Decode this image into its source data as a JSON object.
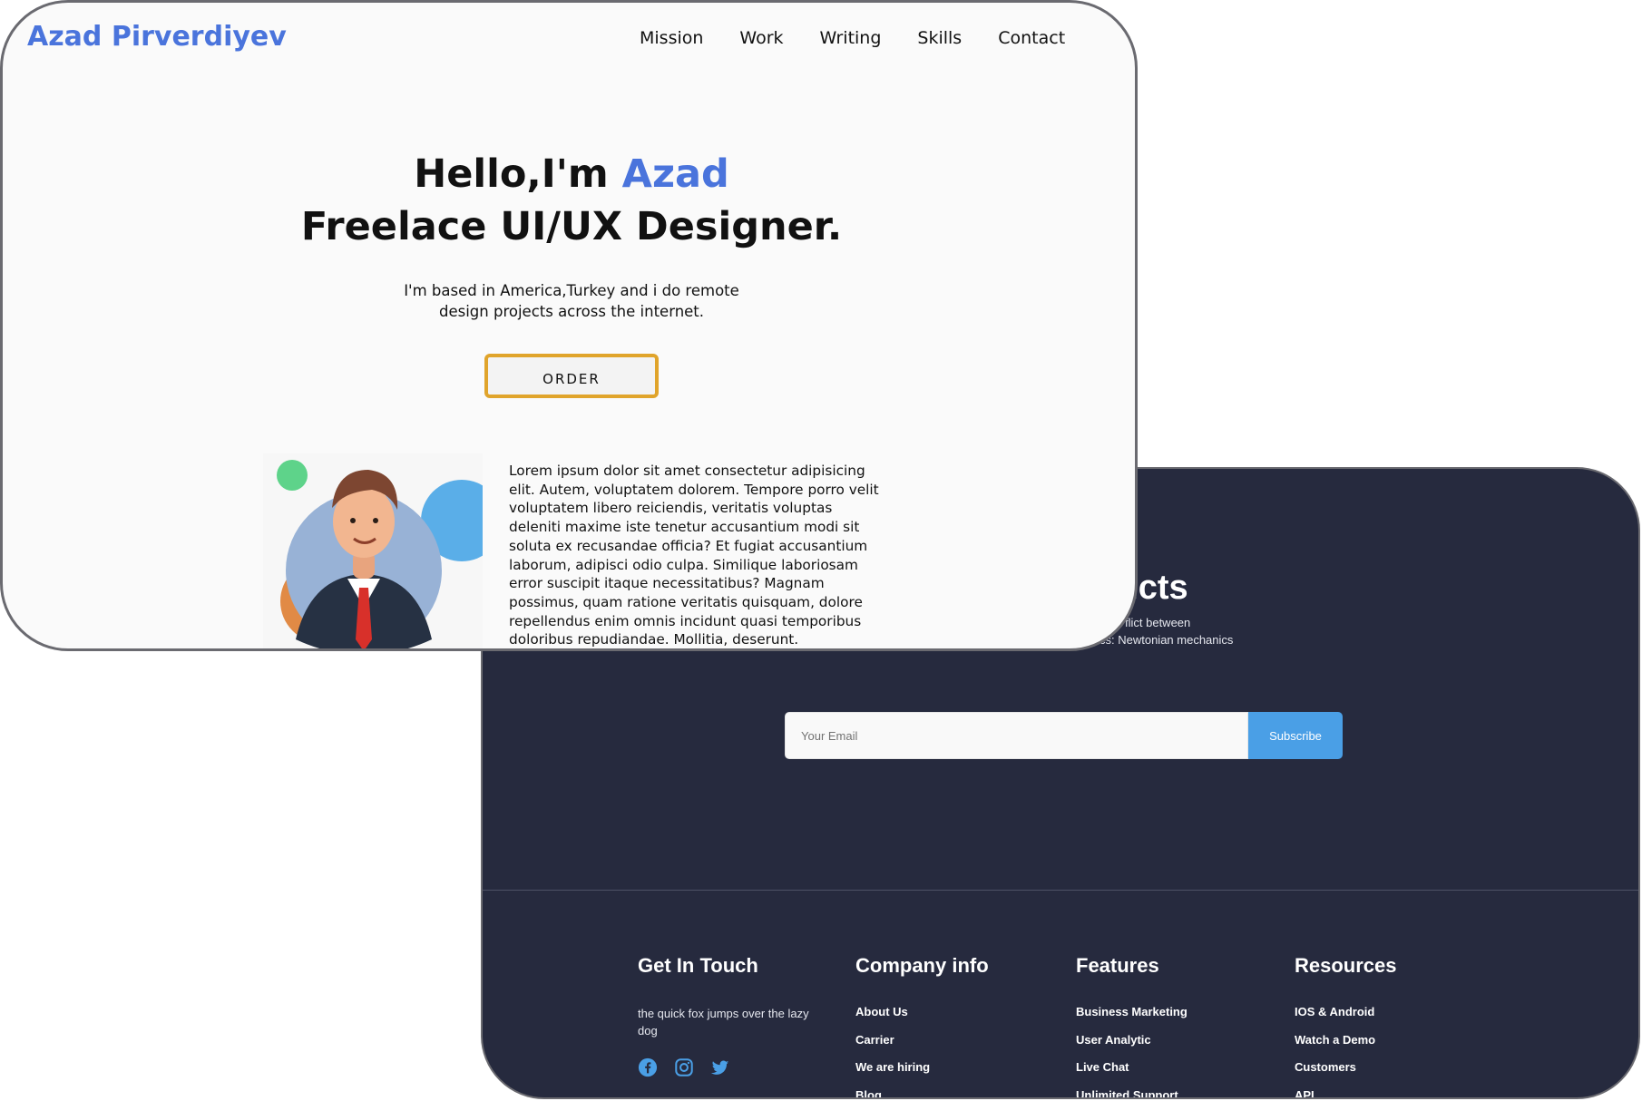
{
  "colors": {
    "brand_blue": "#4a74dc",
    "order_border": "#e0a42b",
    "dark_bg": "#262a3e",
    "subscribe_bg": "#4a9fe6"
  },
  "header": {
    "logo": "Azad Pirverdiyev",
    "nav": [
      "Mission",
      "Work",
      "Writing",
      "Skills",
      "Contact"
    ]
  },
  "hero": {
    "title_prefix": "Hello,I'm ",
    "title_name": "Azad",
    "title_line2": "Freelace UI/UX Designer.",
    "subtitle_line1": "I'm based in America,Turkey and i do remote",
    "subtitle_line2": "design projects across the internet.",
    "order_label": "ORDER"
  },
  "about": {
    "avatar_icon": "avatar-illustration",
    "text": "Lorem ipsum dolor sit amet consectetur adipisicing elit. Autem, voluptatem dolorem. Tempore porro velit voluptatem libero reiciendis, veritatis voluptas deleniti maxime iste tenetur accusantium modi sit soluta ex recusandae officia? Et fugiat accusantium laborum, adipisci odio culpa. Similique laboriosam error suscipit itaque necessitatibus? Magnam possimus, quam ratione veritatis quisquam, dolore repellendus enim omnis incidunt quasi temporibus doloribus repudiandae. Mollitia, deserunt."
  },
  "newsletter": {
    "heading_fragment": "lucts",
    "sub_line1": "flict between",
    "sub_line2": "cs: Newtonian mechanics",
    "email_placeholder": "Your Email",
    "subscribe_label": "Subscribe"
  },
  "footer": {
    "get_in_touch": {
      "title": "Get In Touch",
      "text": "the quick fox jumps over the lazy dog",
      "social_icons": [
        "facebook-icon",
        "instagram-icon",
        "twitter-icon"
      ]
    },
    "company_info": {
      "title": "Company info",
      "links": [
        "About Us",
        "Carrier",
        "We are hiring",
        "Blog"
      ]
    },
    "features": {
      "title": "Features",
      "links": [
        "Business Marketing",
        "User Analytic",
        "Live Chat",
        "Unlimited Support"
      ]
    },
    "resources": {
      "title": "Resources",
      "links": [
        "IOS & Android",
        "Watch a Demo",
        "Customers",
        "API"
      ]
    }
  }
}
